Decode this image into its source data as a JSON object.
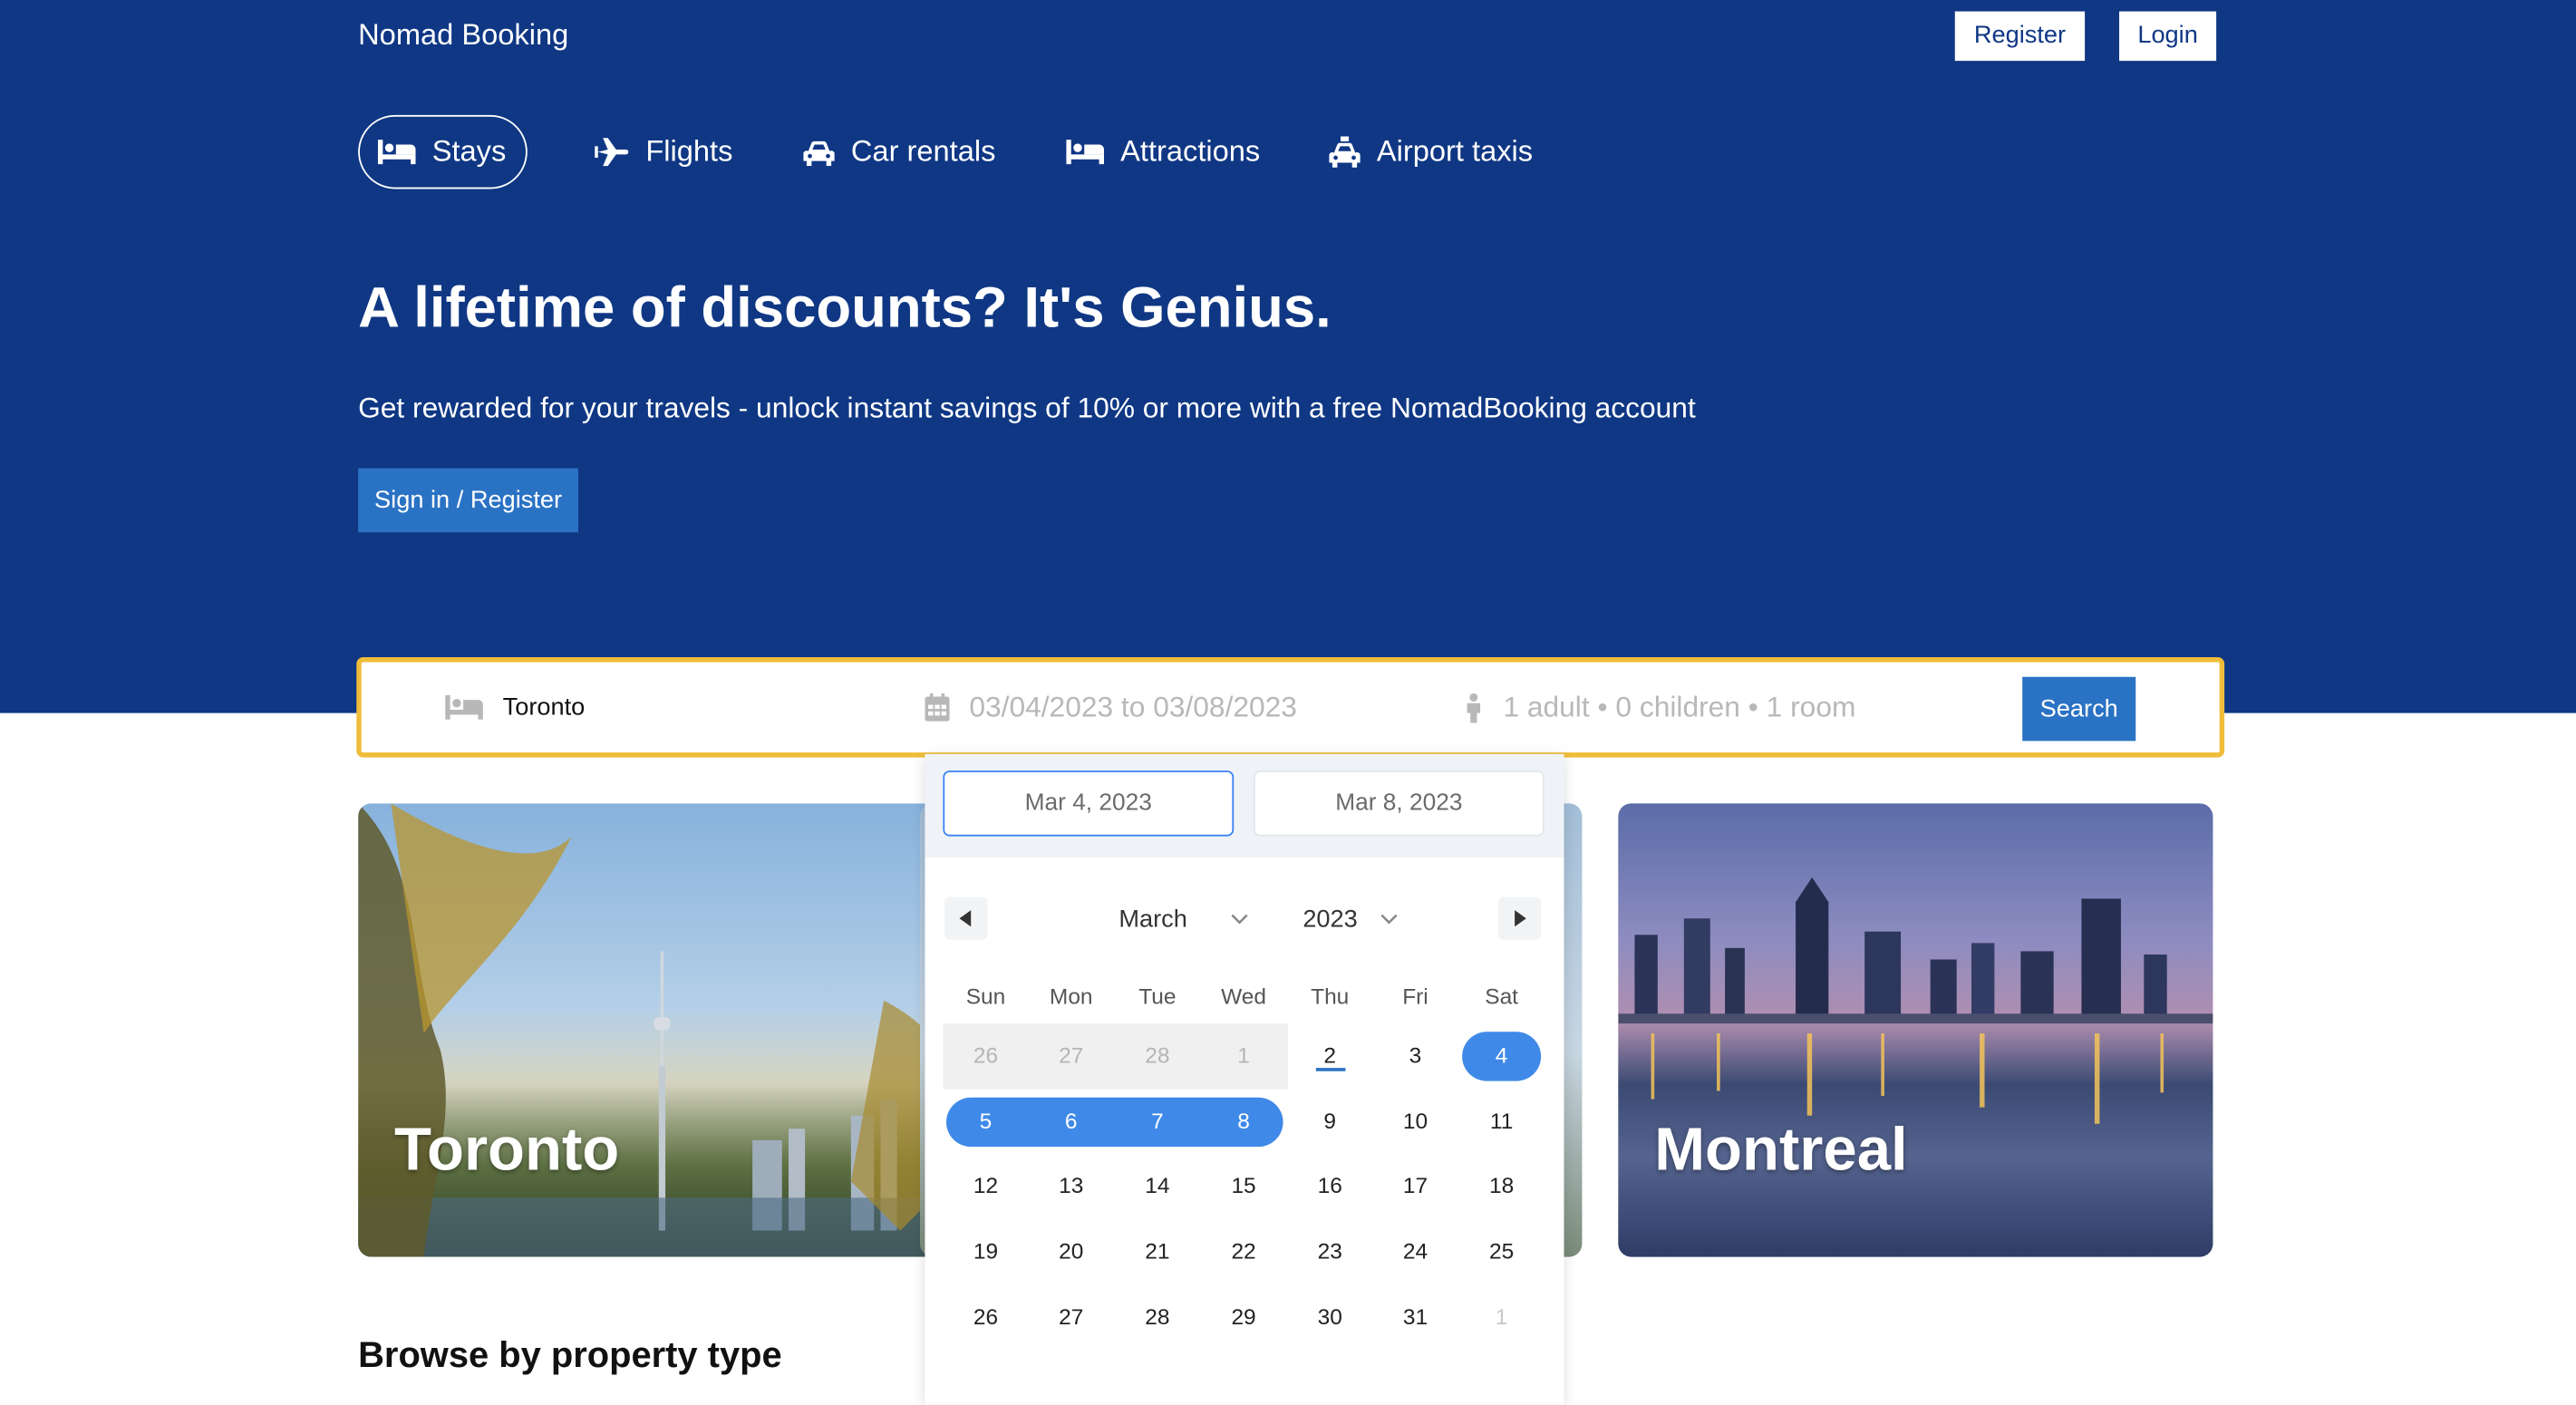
{
  "header": {
    "brand": "Nomad Booking",
    "register_label": "Register",
    "login_label": "Login"
  },
  "nav": {
    "items": [
      {
        "label": "Stays",
        "icon": "bed-icon"
      },
      {
        "label": "Flights",
        "icon": "plane-icon"
      },
      {
        "label": "Car rentals",
        "icon": "car-icon"
      },
      {
        "label": "Attractions",
        "icon": "bed-icon"
      },
      {
        "label": "Airport taxis",
        "icon": "taxi-icon"
      }
    ],
    "active": "Stays"
  },
  "hero": {
    "title": "A lifetime of discounts? It's Genius.",
    "subtitle": "Get rewarded for your travels - unlock instant savings of 10% or more with a free NomadBooking account",
    "cta_label": "Sign in / Register"
  },
  "search": {
    "destination": "Toronto",
    "dates": "03/04/2023 to 03/08/2023",
    "guests": "1 adult • 0 children • 1 room",
    "button_label": "Search"
  },
  "datepicker": {
    "start_date": "Mar 4, 2023",
    "end_date": "Mar 8, 2023",
    "month": "March",
    "year": "2023",
    "weekdays": [
      "Sun",
      "Mon",
      "Tue",
      "Wed",
      "Thu",
      "Fri",
      "Sat"
    ],
    "weeks": [
      [
        "26",
        "27",
        "28",
        "1",
        "2",
        "3",
        "4"
      ],
      [
        "5",
        "6",
        "7",
        "8",
        "9",
        "10",
        "11"
      ],
      [
        "12",
        "13",
        "14",
        "15",
        "16",
        "17",
        "18"
      ],
      [
        "19",
        "20",
        "21",
        "22",
        "23",
        "24",
        "25"
      ],
      [
        "26",
        "27",
        "28",
        "29",
        "30",
        "31",
        "1"
      ]
    ],
    "today": "2",
    "selected_start": "4",
    "selected_end": "8"
  },
  "destinations": [
    {
      "name": "Toronto"
    },
    {
      "name": "Montreal"
    }
  ],
  "browse": {
    "title": "Browse by property type"
  },
  "colors": {
    "header_bg": "#0f3784",
    "primary_button": "#2a72c4",
    "search_border": "#f0bd3b",
    "selected_day": "#3f8ae8"
  }
}
